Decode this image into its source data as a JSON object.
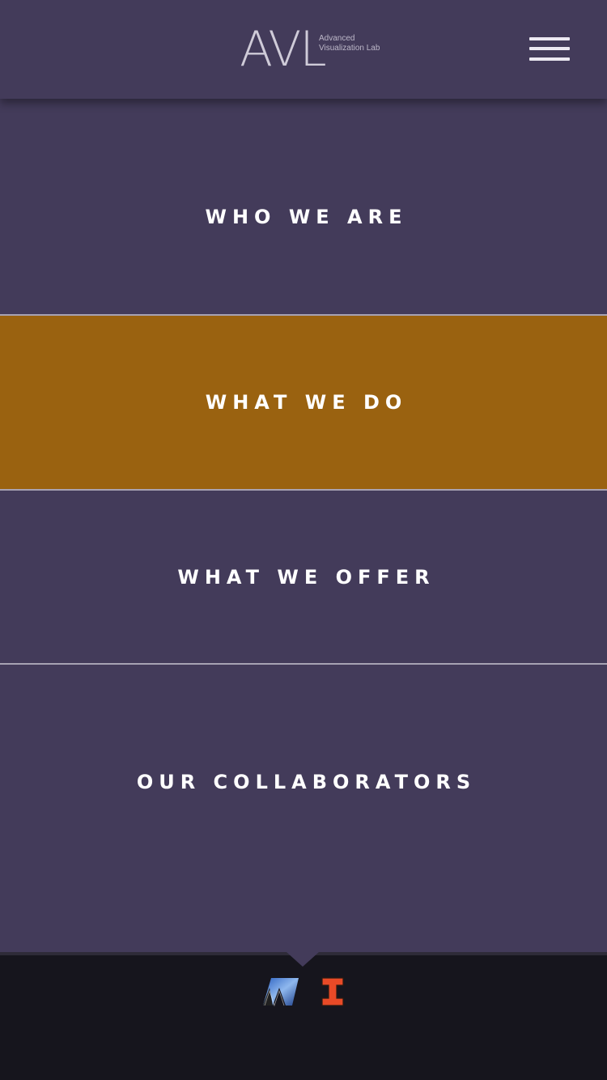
{
  "header": {
    "logo_mark": "AVL",
    "logo_subtitle_line1": "Advanced",
    "logo_subtitle_line2": "Visualization Lab",
    "menu_icon": "hamburger-menu-icon"
  },
  "menu": {
    "items": [
      {
        "label": "WHO WE ARE",
        "active": false
      },
      {
        "label": "WHAT WE DO",
        "active": true
      },
      {
        "label": "WHAT WE OFFER",
        "active": false
      },
      {
        "label": "OUR COLLABORATORS",
        "active": false
      }
    ]
  },
  "footer": {
    "logos": [
      "ncsa-logo",
      "illinois-block-i-logo"
    ]
  },
  "colors": {
    "background": "#433b5a",
    "active": "#9a6210",
    "footer": "#16151d",
    "text": "#ffffff",
    "illinois_orange": "#e84a27"
  }
}
